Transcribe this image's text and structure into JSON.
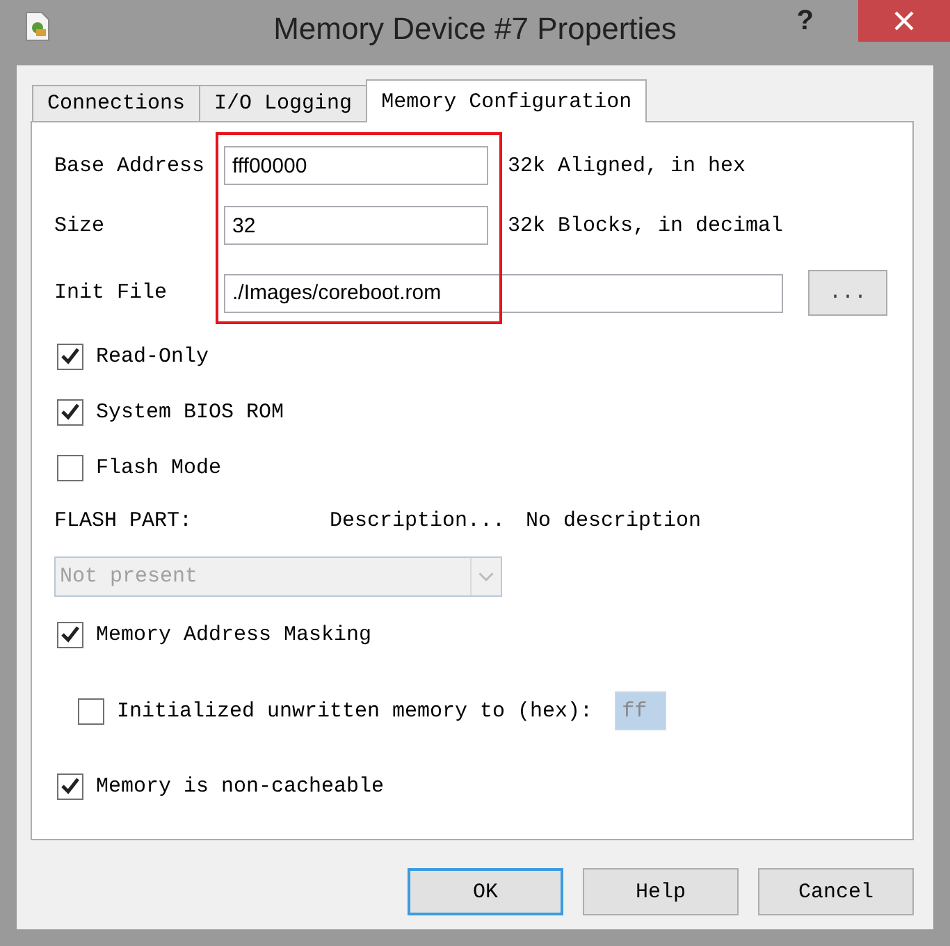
{
  "window": {
    "title": "Memory Device #7 Properties",
    "help": "?"
  },
  "tabs": [
    {
      "label": "Connections",
      "selected": false
    },
    {
      "label": "I/O Logging",
      "selected": false
    },
    {
      "label": "Memory Configuration",
      "selected": true
    }
  ],
  "fields": [
    {
      "label": "Base Address",
      "value": "fff00000",
      "hint": "32k Aligned, in hex"
    },
    {
      "label": "Size",
      "value": "32",
      "hint": "32k Blocks, in decimal"
    }
  ],
  "init_file": {
    "label": "Init File",
    "value": "./Images/coreboot.rom",
    "browse": "..."
  },
  "options": [
    {
      "label": "Read-Only",
      "checked": true
    },
    {
      "label": "System BIOS ROM",
      "checked": true
    },
    {
      "label": "Flash Mode",
      "checked": false
    }
  ],
  "flash_part": {
    "label": "FLASH PART:",
    "description_label": "Description...",
    "description": "No description",
    "select": {
      "value": "Not present",
      "disabled": true
    }
  },
  "masking": {
    "label": "Memory Address Masking",
    "checked": true
  },
  "init_unwritten": {
    "label": "Initialized unwritten memory to (hex):",
    "checked": false,
    "value": "ff",
    "disabled": true
  },
  "non_cacheable": {
    "label": "Memory is non-cacheable",
    "checked": true
  },
  "buttons": [
    {
      "label": "OK",
      "default": true
    },
    {
      "label": "Help",
      "default": false
    },
    {
      "label": "Cancel",
      "default": false
    }
  ]
}
